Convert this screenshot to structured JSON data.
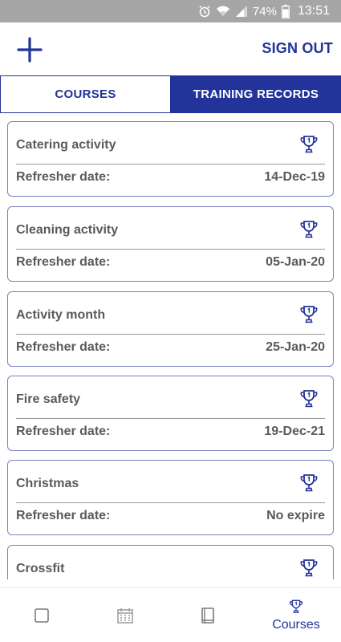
{
  "status_bar": {
    "battery_percent": "74%",
    "time": "13:51",
    "icons": [
      "alarm-icon",
      "wifi-icon",
      "signal-icon",
      "battery-icon"
    ]
  },
  "header": {
    "add_icon": "plus-icon",
    "sign_out_label": "SIGN OUT"
  },
  "tabs": {
    "courses_label": "COURSES",
    "training_records_label": "TRAINING RECORDS",
    "active": "TRAINING RECORDS"
  },
  "records": [
    {
      "title": "Catering activity",
      "label": "Refresher date:",
      "value": "14-Dec-19",
      "icon": "trophy-icon"
    },
    {
      "title": "Cleaning activity",
      "label": "Refresher date:",
      "value": "05-Jan-20",
      "icon": "trophy-icon"
    },
    {
      "title": "Activity month",
      "label": "Refresher date:",
      "value": "25-Jan-20",
      "icon": "trophy-icon"
    },
    {
      "title": "Fire safety",
      "label": "Refresher date:",
      "value": "19-Dec-21",
      "icon": "trophy-icon"
    },
    {
      "title": "Christmas",
      "label": "Refresher date:",
      "value": "No expire",
      "icon": "trophy-icon"
    },
    {
      "title": "Crossfit",
      "label": "",
      "value": "",
      "icon": "trophy-icon"
    }
  ],
  "bottom_nav": {
    "items": [
      {
        "icon": "checkbox-icon",
        "label": ""
      },
      {
        "icon": "calendar-icon",
        "label": ""
      },
      {
        "icon": "book-icon",
        "label": ""
      },
      {
        "icon": "trophy-icon",
        "label": "Courses"
      }
    ],
    "active_index": 3
  },
  "colors": {
    "accent": "#22339a",
    "status_bar": "#a6a6a6",
    "text": "#5a5a5a",
    "card_border": "#7b82bd",
    "inactive_icon": "#9a9a9a"
  }
}
